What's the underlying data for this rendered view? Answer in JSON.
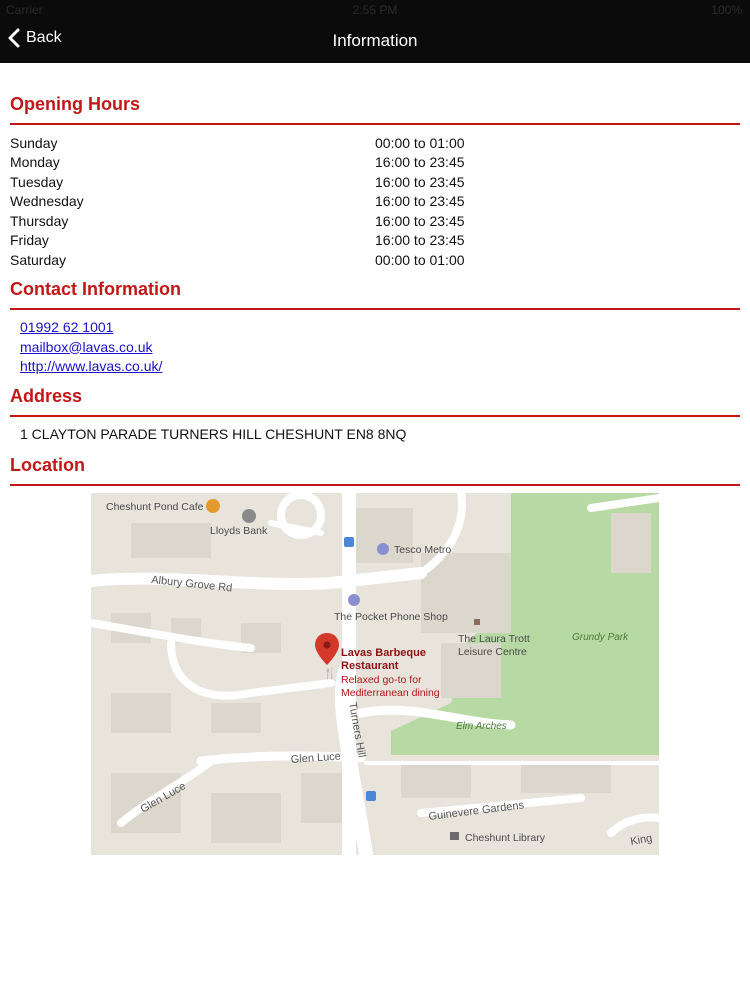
{
  "status_bar": {
    "carrier": "Carrier",
    "time": "2:55 PM",
    "battery": "100%"
  },
  "nav": {
    "back_label": "Back",
    "title": "Information"
  },
  "opening_hours": {
    "title": "Opening Hours",
    "rows": [
      {
        "day": "Sunday",
        "hours": "00:00 to 01:00"
      },
      {
        "day": "Monday",
        "hours": "16:00 to 23:45"
      },
      {
        "day": "Tuesday",
        "hours": "16:00 to 23:45"
      },
      {
        "day": "Wednesday",
        "hours": "16:00 to 23:45"
      },
      {
        "day": "Thursday",
        "hours": "16:00 to 23:45"
      },
      {
        "day": "Friday",
        "hours": "16:00 to 23:45"
      },
      {
        "day": "Saturday",
        "hours": "00:00 to 01:00"
      }
    ]
  },
  "contact": {
    "title": "Contact Information",
    "phone": "01992 62 1001",
    "email": "mailbox@lavas.co.uk",
    "website": "http://www.lavas.co.uk/"
  },
  "address": {
    "title": "Address",
    "text": "1 CLAYTON PARADE TURNERS HILL CHESHUNT EN8 8NQ"
  },
  "location": {
    "title": "Location",
    "map": {
      "labels": {
        "pond_cafe": "Cheshunt Pond Cafe",
        "lloyds": "Lloyds Bank",
        "tesco": "Tesco Metro",
        "albury": "Albury Grove Rd",
        "pocket_phone": "The Pocket Phone Shop",
        "laura_trott_1": "The Laura Trott",
        "laura_trott_2": "Leisure Centre",
        "grundy": "Grundy Park",
        "lavas_1": "Lavas Barbeque",
        "lavas_2": "Restaurant",
        "lavas_desc_1": "Relaxed go-to for",
        "lavas_desc_2": "Mediterranean dining",
        "turners": "Turners Hill",
        "elm": "Elm Arches",
        "glen_luce_1": "Glen Luce",
        "glen_luce_2": "Glen Luce",
        "guinevere": "Guinevere Gardens",
        "library": "Cheshunt Library",
        "king": "King"
      },
      "colors": {
        "park": "#b7d9a4",
        "land": "#e8e4dc",
        "building": "#dcd7cd",
        "road": "#ffffff",
        "pin": "#d4382b"
      }
    }
  }
}
